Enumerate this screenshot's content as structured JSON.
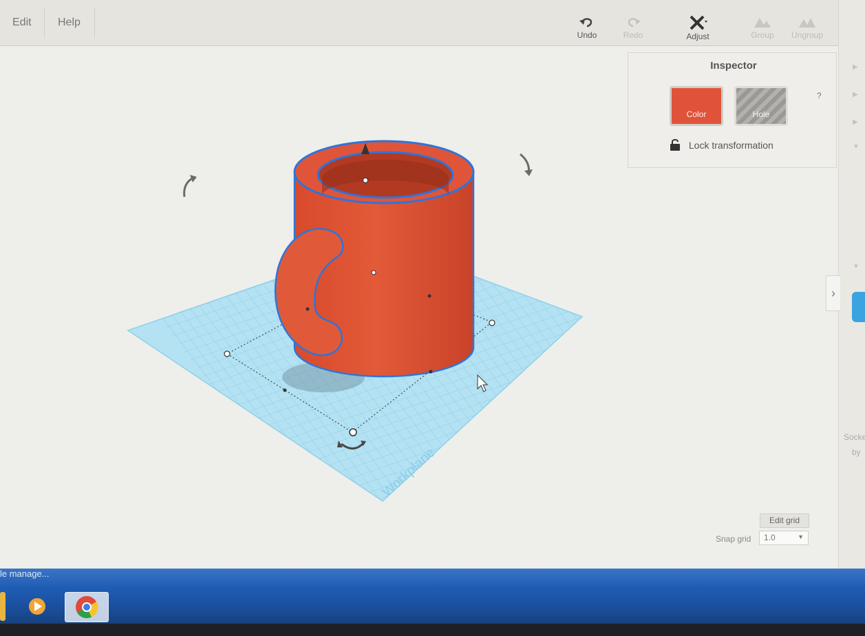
{
  "menubar": {
    "edit_label": "Edit",
    "help_label": "Help"
  },
  "toolbar": {
    "undo_label": "Undo",
    "redo_label": "Redo",
    "adjust_label": "Adjust",
    "group_label": "Group",
    "ungroup_label": "Ungroup"
  },
  "inspector": {
    "title": "Inspector",
    "color_label": "Color",
    "hole_label": "Hole",
    "help": "?",
    "lock_label": "Lock transformation",
    "selected_color": "#e0533a"
  },
  "workplane": {
    "label": "Workplane"
  },
  "grid_controls": {
    "edit_grid_label": "Edit grid",
    "snap_grid_label": "Snap grid",
    "snap_value": "1.0"
  },
  "side_panel": {
    "text_1": "Socke",
    "text_2": "by"
  },
  "taskbar": {
    "window_title": "le manage..."
  },
  "colors": {
    "accent_selection": "#2f74d9",
    "object": "#e0533a",
    "workplane": "#a9dcef"
  }
}
